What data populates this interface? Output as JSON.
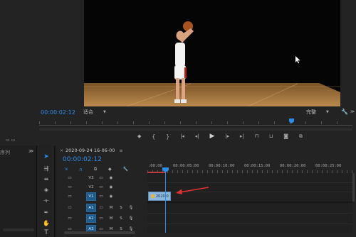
{
  "program": {
    "timecode": "00:00:02:12",
    "fit_label": "适合",
    "quality_label": "完整",
    "transport_icons": [
      "marker-icon",
      "mark-in-icon",
      "mark-out-icon",
      "go-to-in-icon",
      "step-back-icon",
      "play-icon",
      "step-forward-icon",
      "go-to-out-icon",
      "lift-icon",
      "extract-icon",
      "export-frame-icon",
      "comparison-view-icon"
    ]
  },
  "left_panel": {
    "partial_label": "序列"
  },
  "timeline": {
    "tab_label": "2020-09-24 16-06-00",
    "timecode": "00:00:02:12",
    "ruler_labels": [
      ":00:00",
      "00:00:05:00",
      "00:00:10:00",
      "00:00:15:00",
      "00:00:20:00",
      "00:00:25:00"
    ],
    "video_tracks": [
      "V3",
      "V2",
      "V1"
    ],
    "audio_tracks": [
      "A1",
      "A2",
      "A3"
    ],
    "audio_m": "M",
    "audio_s": "S",
    "clip_label": "2020-0",
    "playhead_color": "#2d8ceb",
    "clip_color": "#8db6dd",
    "arrow_color": "#e03030"
  },
  "tools": [
    "selection-tool-icon",
    "track-select-icon",
    "ripple-edit-icon",
    "razor-icon",
    "slip-icon",
    "pen-icon",
    "hand-icon",
    "type-icon"
  ]
}
